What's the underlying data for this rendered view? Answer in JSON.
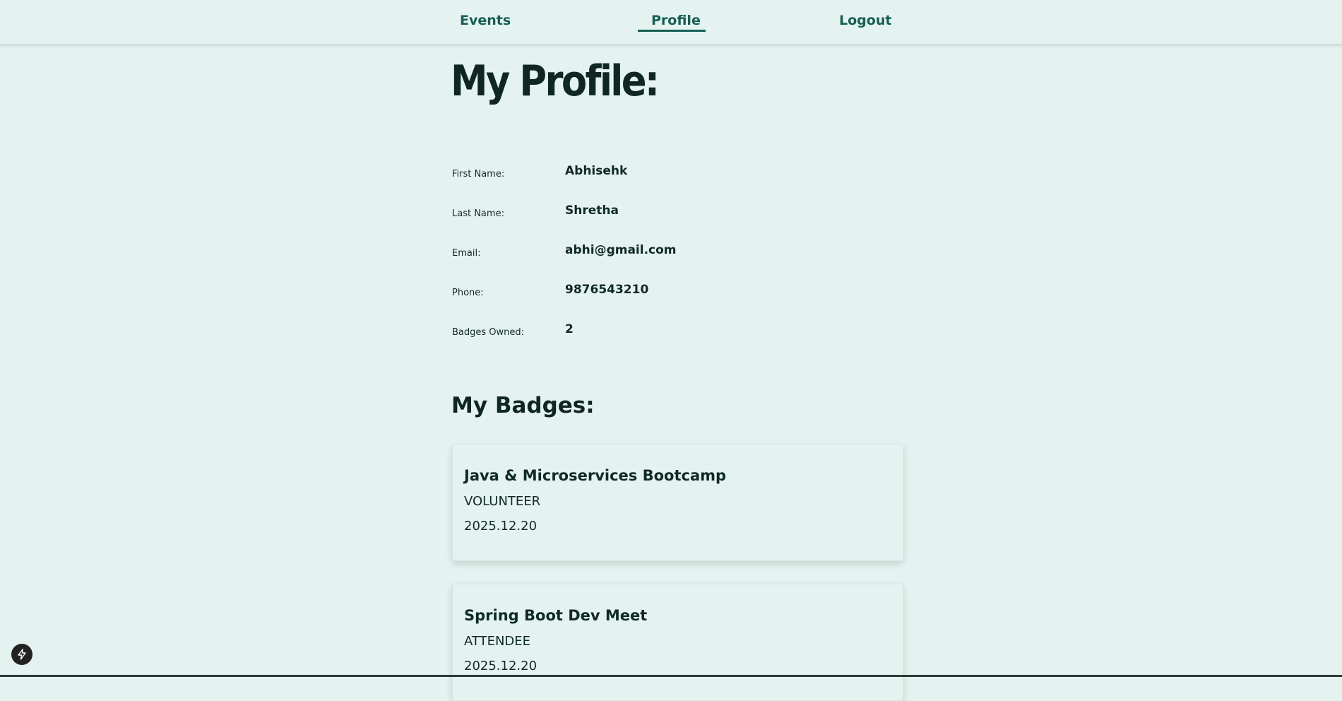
{
  "nav": {
    "events": "Events",
    "profile": "Profile",
    "logout": "Logout",
    "active": "Profile",
    "accent_color": "#165f54"
  },
  "profile": {
    "title": "My Profile:",
    "fields": [
      {
        "label": "First Name:",
        "value": "Abhisehk"
      },
      {
        "label": "Last Name:",
        "value": "Shretha"
      },
      {
        "label": "Email:",
        "value": "abhi@gmail.com"
      },
      {
        "label": "Phone:",
        "value": "9876543210"
      },
      {
        "label": "Badges Owned:",
        "value": "2"
      }
    ]
  },
  "badges": {
    "title": "My Badges:",
    "items": [
      {
        "name": "Java & Microservices Bootcamp",
        "role": "VOLUNTEER",
        "date": "2025.12.20"
      },
      {
        "name": "Spring Boot Dev Meet",
        "role": "ATTENDEE",
        "date": "2025.12.20"
      }
    ]
  },
  "icons": {
    "dev_tools": "lightning-icon"
  },
  "colors": {
    "background": "#e4f3f0",
    "text": "#102a26"
  }
}
